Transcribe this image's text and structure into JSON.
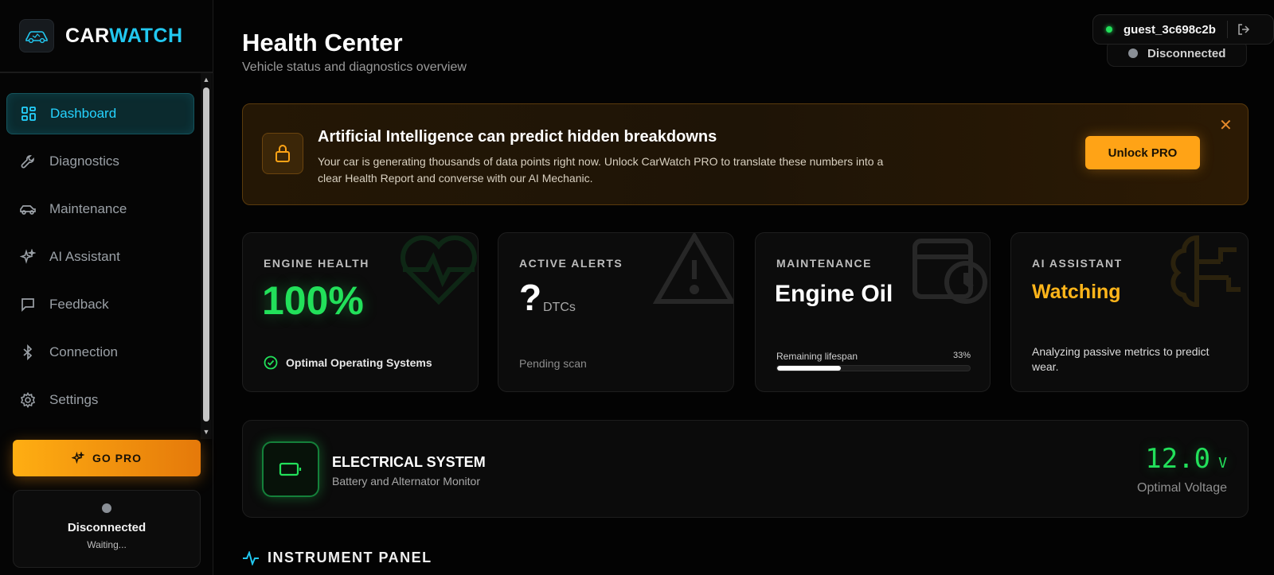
{
  "brand": {
    "part1": "CAR",
    "part2": "WATCH"
  },
  "sidebar": {
    "items": [
      {
        "label": "Dashboard",
        "icon": "dashboard-grid-icon",
        "active": true
      },
      {
        "label": "Diagnostics",
        "icon": "wrench-icon",
        "active": false
      },
      {
        "label": "Maintenance",
        "icon": "car-icon",
        "active": false
      },
      {
        "label": "AI Assistant",
        "icon": "sparkles-icon",
        "active": false
      },
      {
        "label": "Feedback",
        "icon": "message-square-icon",
        "active": false
      },
      {
        "label": "Connection",
        "icon": "bluetooth-icon",
        "active": false
      },
      {
        "label": "Settings",
        "icon": "gear-icon",
        "active": false
      }
    ],
    "gopro_label": "GO PRO",
    "connection": {
      "title": "Disconnected",
      "subtitle": "Waiting..."
    }
  },
  "header": {
    "title": "Health Center",
    "subtitle": "Vehicle status and diagnostics overview",
    "user": "guest_3c698c2b",
    "status": "Disconnected"
  },
  "banner": {
    "title": "Artificial Intelligence can predict hidden breakdowns",
    "text": "Your car is generating thousands of data points right now. Unlock CarWatch PRO to translate these numbers into a clear Health Report and converse with our AI Mechanic.",
    "button": "Unlock PRO",
    "close": "✕"
  },
  "cards": {
    "engine": {
      "label": "ENGINE HEALTH",
      "value": "100%",
      "footer": "Optimal Operating Systems"
    },
    "alerts": {
      "label": "ACTIVE ALERTS",
      "value": "?",
      "unit": "DTCs",
      "footer": "Pending scan"
    },
    "maintenance": {
      "label": "MAINTENANCE",
      "value": "Engine Oil",
      "lifespan_label": "Remaining lifespan",
      "lifespan_pct": "33%",
      "lifespan_fraction": 0.33
    },
    "ai": {
      "label": "AI ASSISTANT",
      "value": "Watching",
      "footer": "Analyzing passive metrics to predict wear."
    }
  },
  "electrical": {
    "title": "ELECTRICAL SYSTEM",
    "subtitle": "Battery and Alternator Monitor",
    "voltage": "12.0",
    "unit": "V",
    "status": "Optimal Voltage"
  },
  "instrument_panel": {
    "title": "INSTRUMENT PANEL"
  },
  "colors": {
    "accent_cyan": "#22c8f0",
    "accent_green": "#22e05a",
    "accent_orange": "#ffa316",
    "background": "#030303"
  }
}
